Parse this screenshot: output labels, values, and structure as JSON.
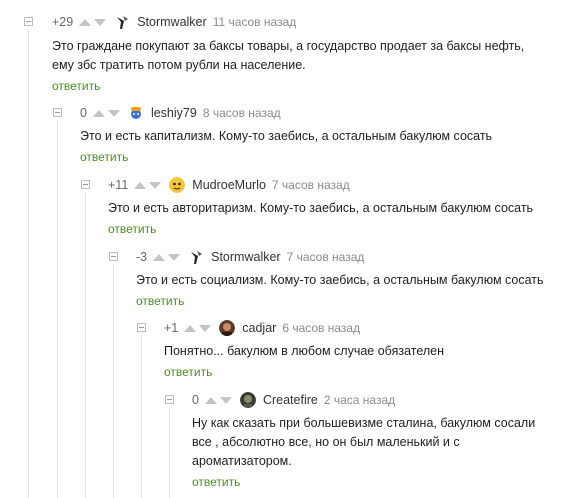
{
  "reply_label": "ответить",
  "comments": [
    {
      "rating": "+29",
      "username": "Stormwalker",
      "time": "11 часов назад",
      "text_lines": [
        "Это граждане покупают за баксы товары, а государство продает за баксы нефть,",
        "ему збс тратить потом рубли на население."
      ],
      "avatar": "stormwalker-avatar"
    },
    {
      "rating": "0",
      "username": "leshiy79",
      "time": "8 часов назад",
      "text_lines": [
        "Это и есть капитализм. Кому-то заебись, а остальным бакулюм сосать"
      ],
      "avatar": "leshiy-avatar"
    },
    {
      "rating": "+11",
      "username": "MudroeMurlo",
      "time": "7 часов назад",
      "text_lines": [
        "Это и есть авторитаризм. Кому-то заебись, а остальным бакулюм сосать"
      ],
      "avatar": "mudroe-avatar"
    },
    {
      "rating": "-3",
      "username": "Stormwalker",
      "time": "7 часов назад",
      "text_lines": [
        "Это и есть социализм. Кому-то заебись, а остальным бакулюм сосать"
      ],
      "avatar": "stormwalker-avatar"
    },
    {
      "rating": "+1",
      "username": "cadjar",
      "time": "6 часов назад",
      "text_lines": [
        "Понятно... бакулюм в любом случае обязателен"
      ],
      "avatar": "cadjar-avatar"
    },
    {
      "rating": "0",
      "username": "Createfire",
      "time": "2 часа назад",
      "text_lines": [
        "Ну как сказать при большевизме сталина, бакулюм сосали",
        "все , абсолютно все, но он был  маленький и с",
        "ароматизатором."
      ],
      "avatar": "createfire-avatar"
    }
  ]
}
